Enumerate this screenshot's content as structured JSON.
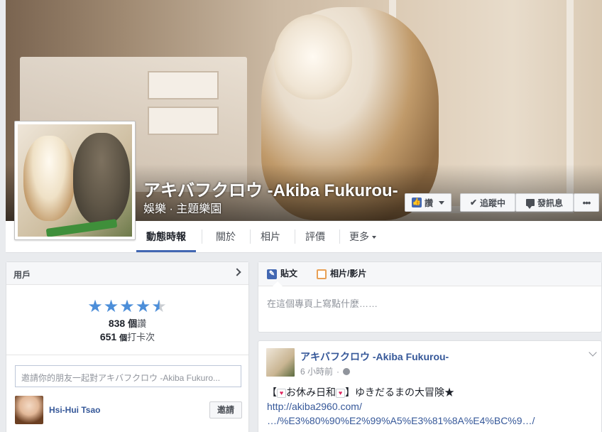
{
  "page": {
    "name": "アキバフクロウ -Akiba Fukurou-",
    "category": "娛樂 · 主題樂園"
  },
  "actions": {
    "like": "讚",
    "following": "追蹤中",
    "message": "發訊息",
    "more": "•••"
  },
  "tabs": [
    {
      "label": "動態時報"
    },
    {
      "label": "關於"
    },
    {
      "label": "相片"
    },
    {
      "label": "評價"
    },
    {
      "label": "更多"
    }
  ],
  "sidebar": {
    "header": "用戶",
    "rating": 4.5,
    "stars": "★★★★",
    "half_star": "★",
    "likes_count": "838",
    "likes_unit_bold": "個",
    "likes_unit": "讚",
    "checkins_count": "651",
    "checkins_unit_small": "個",
    "checkins_unit": "打卡次",
    "invite_placeholder": "邀請你的朋友一起對アキバフクロウ -Akiba Fukuro...",
    "friend_name": "Hsi-Hui Tsao",
    "invite_button": "邀請"
  },
  "composer": {
    "tab_post": "貼文",
    "tab_photo": "相片/影片",
    "placeholder": "在這個專頁上寫點什麼……"
  },
  "post": {
    "author": "アキバフクロウ -Akiba Fukurou-",
    "time": "6 小時前",
    "dot": "·",
    "text_open": "【",
    "emoji": "♥",
    "text_1": "お休み日和",
    "text_2": "】ゆきだるまの大冒険★",
    "link_1": "http://akiba2960.com/",
    "link_2": "…/%E3%80%90%E2%99%A5%E3%81%8A%E4%BC%9…/"
  },
  "colors": {
    "accent": "#4267b2",
    "link": "#365899",
    "star": "#4c8ed9",
    "background": "#e9ebee"
  }
}
